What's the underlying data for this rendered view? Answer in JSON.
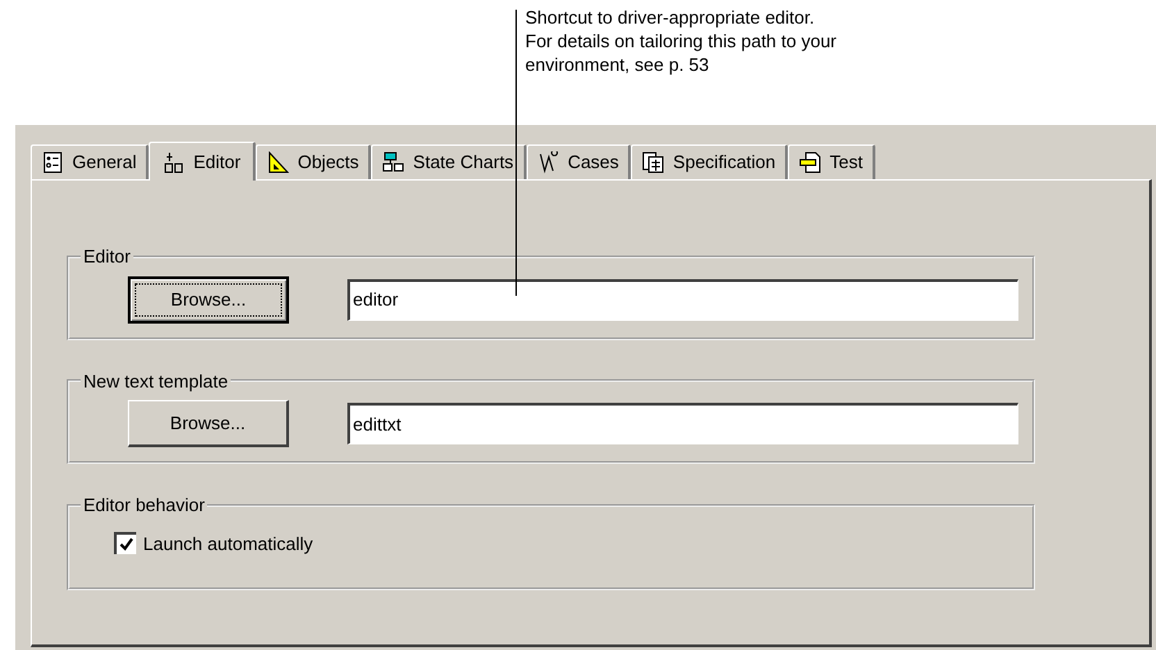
{
  "callout": {
    "lines": [
      "Shortcut to driver-appropriate editor.",
      "For details on tailoring this path to your",
      "environment, see p. 53"
    ]
  },
  "tabs": [
    {
      "label": "General",
      "selected": false
    },
    {
      "label": "Editor",
      "selected": true
    },
    {
      "label": "Objects",
      "selected": false
    },
    {
      "label": "State Charts",
      "selected": false
    },
    {
      "label": "Cases",
      "selected": false
    },
    {
      "label": "Specification",
      "selected": false
    },
    {
      "label": "Test",
      "selected": false
    }
  ],
  "groups": [
    {
      "kind": "browse",
      "title": "Editor",
      "button": "Browse...",
      "focused": true,
      "value": "editor"
    },
    {
      "kind": "browse",
      "title": "New text template",
      "button": "Browse...",
      "focused": false,
      "value": "edittxt"
    },
    {
      "kind": "checkbox",
      "title": "Editor behavior",
      "label": "Launch automatically",
      "checked": true
    }
  ]
}
